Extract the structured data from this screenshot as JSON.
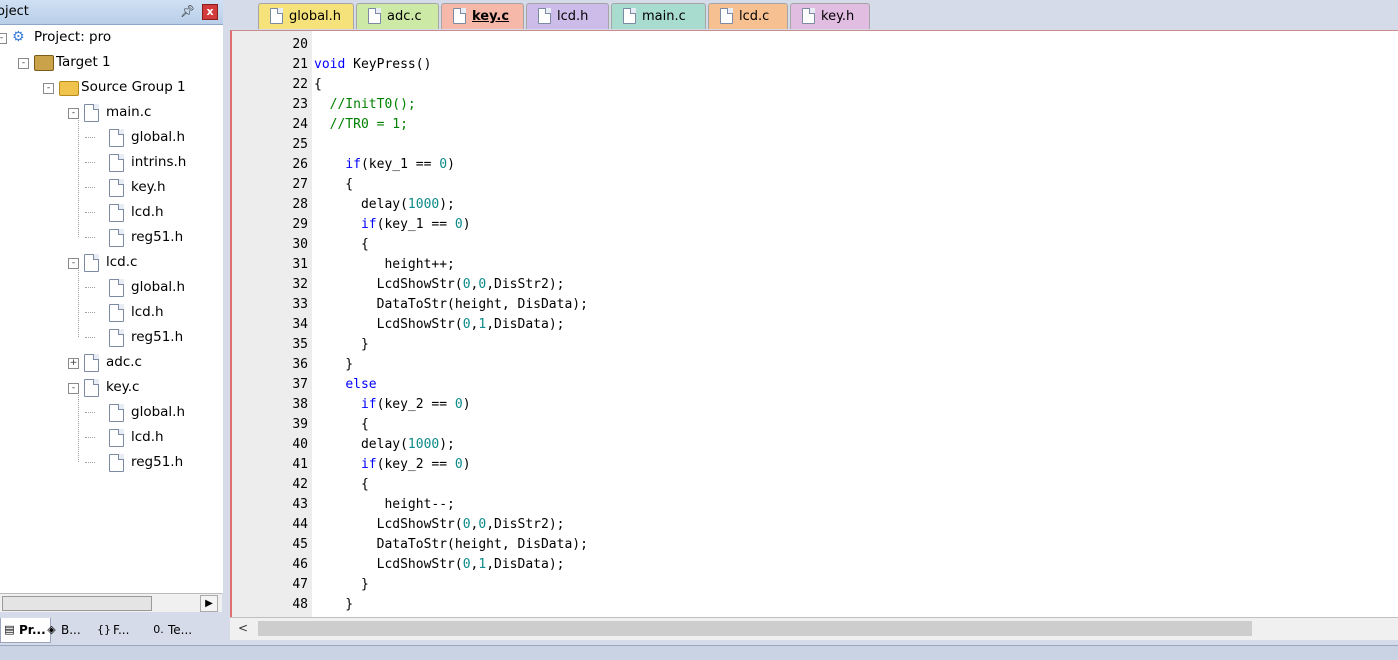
{
  "project_panel": {
    "title": "oject",
    "pin_icon": "pin-icon",
    "close_label": "x",
    "tree": [
      {
        "label": "Project: pro",
        "depth": 0,
        "kind": "project",
        "expand": "-"
      },
      {
        "label": "Target 1",
        "depth": 1,
        "kind": "target",
        "expand": "-"
      },
      {
        "label": "Source Group 1",
        "depth": 2,
        "kind": "folder",
        "expand": "-"
      },
      {
        "label": "main.c",
        "depth": 3,
        "kind": "file",
        "expand": "-"
      },
      {
        "label": "global.h",
        "depth": 4,
        "kind": "file"
      },
      {
        "label": "intrins.h",
        "depth": 4,
        "kind": "file"
      },
      {
        "label": "key.h",
        "depth": 4,
        "kind": "file"
      },
      {
        "label": "lcd.h",
        "depth": 4,
        "kind": "file"
      },
      {
        "label": "reg51.h",
        "depth": 4,
        "kind": "file"
      },
      {
        "label": "lcd.c",
        "depth": 3,
        "kind": "file",
        "expand": "-"
      },
      {
        "label": "global.h",
        "depth": 4,
        "kind": "file"
      },
      {
        "label": "lcd.h",
        "depth": 4,
        "kind": "file"
      },
      {
        "label": "reg51.h",
        "depth": 4,
        "kind": "file"
      },
      {
        "label": "adc.c",
        "depth": 3,
        "kind": "file",
        "expand": "+"
      },
      {
        "label": "key.c",
        "depth": 3,
        "kind": "file",
        "expand": "-"
      },
      {
        "label": "global.h",
        "depth": 4,
        "kind": "file"
      },
      {
        "label": "lcd.h",
        "depth": 4,
        "kind": "file"
      },
      {
        "label": "reg51.h",
        "depth": 4,
        "kind": "file"
      }
    ],
    "bottom_tabs": [
      {
        "label": "Pr...",
        "icon": "project-icon",
        "active": true
      },
      {
        "label": "B...",
        "icon": "books-icon",
        "active": false
      },
      {
        "label": "F...",
        "icon": "functions-icon",
        "glyph": "{}",
        "active": false
      },
      {
        "label": "Te...",
        "icon": "templates-icon",
        "glyph": "0.",
        "active": false
      }
    ]
  },
  "editor_tabs": [
    {
      "label": "global.h",
      "color": "#f6e27a",
      "active": false
    },
    {
      "label": "adc.c",
      "color": "#cde9a6",
      "active": false
    },
    {
      "label": "key.c",
      "color": "#f6b8a8",
      "active": true
    },
    {
      "label": "lcd.h",
      "color": "#cdbbe9",
      "active": false
    },
    {
      "label": "main.c",
      "color": "#a8dccf",
      "active": false
    },
    {
      "label": "lcd.c",
      "color": "#f6c090",
      "active": false
    },
    {
      "label": "key.h",
      "color": "#e2bde2",
      "active": false
    }
  ],
  "code_lines": [
    {
      "n": "20",
      "tokens": []
    },
    {
      "n": "21",
      "tokens": [
        [
          "kw",
          "void"
        ],
        [
          "t",
          " KeyPress()"
        ]
      ]
    },
    {
      "n": "22",
      "tokens": [
        [
          "t",
          "{"
        ]
      ]
    },
    {
      "n": "23",
      "tokens": [
        [
          "cm",
          "  //InitT0();"
        ]
      ]
    },
    {
      "n": "24",
      "tokens": [
        [
          "cm",
          "  //TR0 = 1;"
        ]
      ]
    },
    {
      "n": "25",
      "tokens": []
    },
    {
      "n": "26",
      "tokens": [
        [
          "t",
          "    "
        ],
        [
          "kw",
          "if"
        ],
        [
          "t",
          "(key_1 == "
        ],
        [
          "nm",
          "0"
        ],
        [
          "t",
          ")"
        ]
      ]
    },
    {
      "n": "27",
      "tokens": [
        [
          "t",
          "    {"
        ]
      ]
    },
    {
      "n": "28",
      "tokens": [
        [
          "t",
          "      delay("
        ],
        [
          "nm",
          "1000"
        ],
        [
          "t",
          ");"
        ]
      ]
    },
    {
      "n": "29",
      "tokens": [
        [
          "t",
          "      "
        ],
        [
          "kw",
          "if"
        ],
        [
          "t",
          "(key_1 == "
        ],
        [
          "nm",
          "0"
        ],
        [
          "t",
          ")"
        ]
      ]
    },
    {
      "n": "30",
      "tokens": [
        [
          "t",
          "      {"
        ]
      ]
    },
    {
      "n": "31",
      "tokens": [
        [
          "t",
          "         height++;"
        ]
      ]
    },
    {
      "n": "32",
      "tokens": [
        [
          "t",
          "        LcdShowStr("
        ],
        [
          "nm",
          "0"
        ],
        [
          "t",
          ","
        ],
        [
          "nm",
          "0"
        ],
        [
          "t",
          ",DisStr2);"
        ]
      ]
    },
    {
      "n": "33",
      "tokens": [
        [
          "t",
          "        DataToStr(height, DisData);"
        ]
      ]
    },
    {
      "n": "34",
      "tokens": [
        [
          "t",
          "        LcdShowStr("
        ],
        [
          "nm",
          "0"
        ],
        [
          "t",
          ","
        ],
        [
          "nm",
          "1"
        ],
        [
          "t",
          ",DisData);"
        ]
      ]
    },
    {
      "n": "35",
      "tokens": [
        [
          "t",
          "      }"
        ]
      ]
    },
    {
      "n": "36",
      "tokens": [
        [
          "t",
          "    }"
        ]
      ]
    },
    {
      "n": "37",
      "tokens": [
        [
          "t",
          "    "
        ],
        [
          "kw",
          "else"
        ]
      ]
    },
    {
      "n": "38",
      "tokens": [
        [
          "t",
          "      "
        ],
        [
          "kw",
          "if"
        ],
        [
          "t",
          "(key_2 == "
        ],
        [
          "nm",
          "0"
        ],
        [
          "t",
          ")"
        ]
      ]
    },
    {
      "n": "39",
      "tokens": [
        [
          "t",
          "      {"
        ]
      ]
    },
    {
      "n": "40",
      "tokens": [
        [
          "t",
          "      delay("
        ],
        [
          "nm",
          "1000"
        ],
        [
          "t",
          ");"
        ]
      ]
    },
    {
      "n": "41",
      "tokens": [
        [
          "t",
          "      "
        ],
        [
          "kw",
          "if"
        ],
        [
          "t",
          "(key_2 == "
        ],
        [
          "nm",
          "0"
        ],
        [
          "t",
          ")"
        ]
      ]
    },
    {
      "n": "42",
      "tokens": [
        [
          "t",
          "      {"
        ]
      ]
    },
    {
      "n": "43",
      "tokens": [
        [
          "t",
          "         height--;"
        ]
      ]
    },
    {
      "n": "44",
      "tokens": [
        [
          "t",
          "        LcdShowStr("
        ],
        [
          "nm",
          "0"
        ],
        [
          "t",
          ","
        ],
        [
          "nm",
          "0"
        ],
        [
          "t",
          ",DisStr2);"
        ]
      ]
    },
    {
      "n": "45",
      "tokens": [
        [
          "t",
          "        DataToStr(height, DisData);"
        ]
      ]
    },
    {
      "n": "46",
      "tokens": [
        [
          "t",
          "        LcdShowStr("
        ],
        [
          "nm",
          "0"
        ],
        [
          "t",
          ","
        ],
        [
          "nm",
          "1"
        ],
        [
          "t",
          ",DisData);"
        ]
      ]
    },
    {
      "n": "47",
      "tokens": [
        [
          "t",
          "      }"
        ]
      ]
    },
    {
      "n": "48",
      "tokens": [
        [
          "t",
          "    }"
        ]
      ]
    }
  ],
  "scroll_left_glyph": "<"
}
